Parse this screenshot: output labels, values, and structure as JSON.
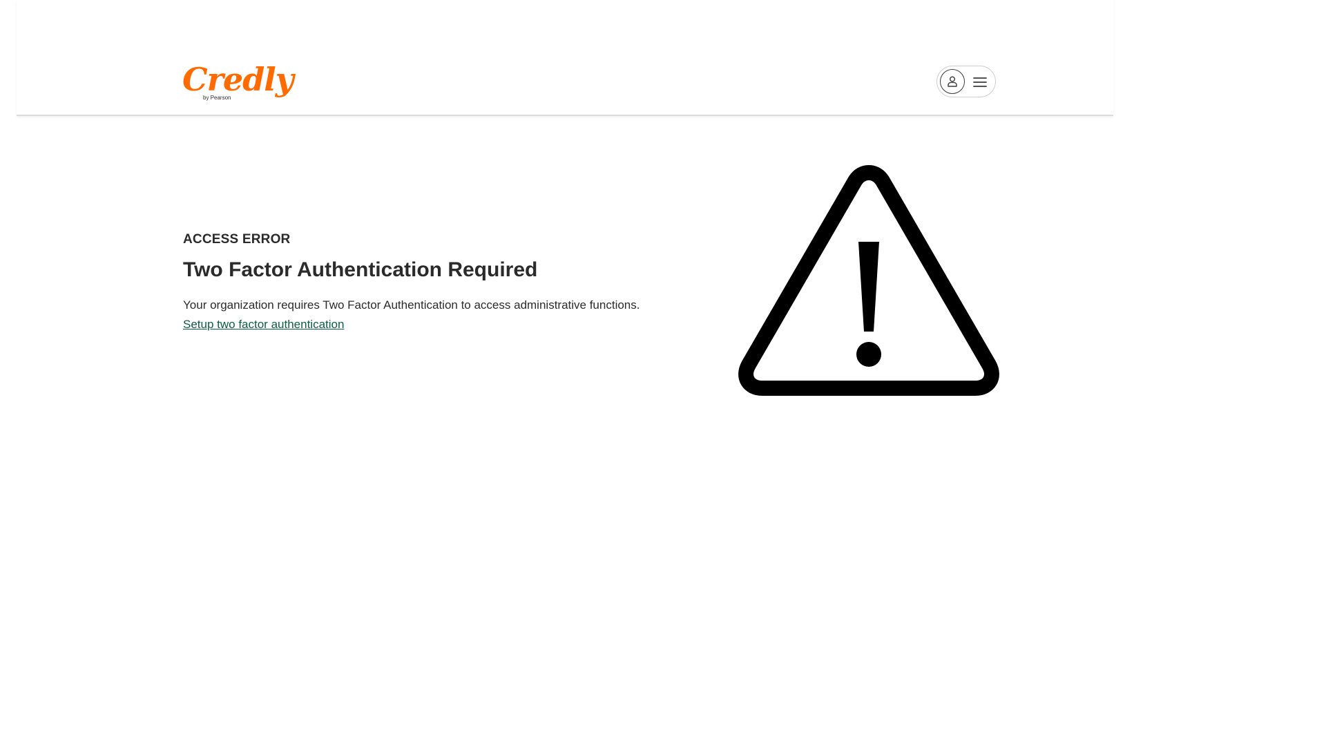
{
  "header": {
    "logo": {
      "wordmark": "Credly",
      "byline": "by Pearson"
    }
  },
  "error": {
    "eyebrow": "ACCESS ERROR",
    "title": "Two Factor Authentication Required",
    "message": "Your organization requires Two Factor Authentication to access administrative functions.",
    "link_label": "Setup two factor authentication"
  },
  "icons": {
    "account": "user-icon",
    "menu": "hamburger-menu-icon",
    "illustration": "warning-triangle-icon"
  },
  "colors": {
    "brand": "#ff6b00",
    "link": "#0b5d43",
    "text": "#2b2b2b",
    "illustration": "#000000"
  }
}
